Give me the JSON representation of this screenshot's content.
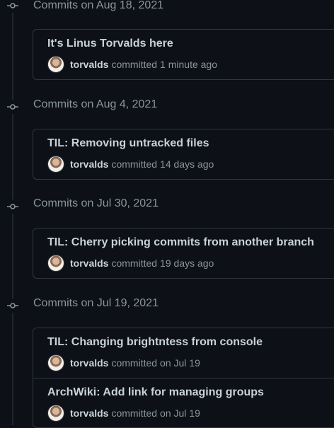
{
  "groups": [
    {
      "date_label": "Commits on Aug 18, 2021",
      "commits": [
        {
          "title": "It's Linus Torvalds here",
          "author": "torvalds",
          "verb": "committed",
          "when": "1 minute ago"
        }
      ]
    },
    {
      "date_label": "Commits on Aug 4, 2021",
      "commits": [
        {
          "title": "TIL: Removing untracked files",
          "author": "torvalds",
          "verb": "committed",
          "when": "14 days ago"
        }
      ]
    },
    {
      "date_label": "Commits on Jul 30, 2021",
      "commits": [
        {
          "title": "TIL: Cherry picking commits from another branch",
          "author": "torvalds",
          "verb": "committed",
          "when": "19 days ago"
        }
      ]
    },
    {
      "date_label": "Commits on Jul 19, 2021",
      "commits": [
        {
          "title": "TIL: Changing brightntess from console",
          "author": "torvalds",
          "verb": "committed",
          "when": "on Jul 19"
        },
        {
          "title": "ArchWiki: Add link for managing groups",
          "author": "torvalds",
          "verb": "committed",
          "when": "on Jul 19"
        }
      ]
    }
  ],
  "colors": {
    "background": "#0d1117",
    "border": "#30363d",
    "muted_text": "#8b949e",
    "primary_text": "#c9d1d9"
  },
  "icons": {
    "group_marker": "git-commit-icon",
    "author_avatar": "avatar"
  }
}
